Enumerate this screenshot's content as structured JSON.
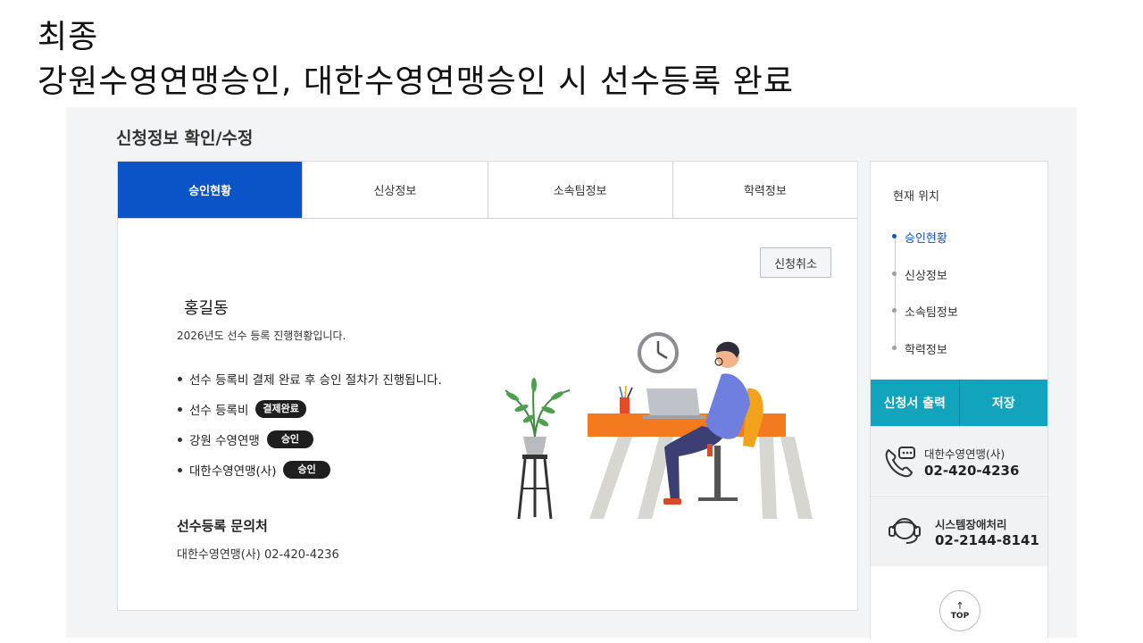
{
  "slide": {
    "line1": "최종",
    "line2": "강원수영연맹승인, 대한수영연맹승인 시 선수등록 완료"
  },
  "page": {
    "title": "신청정보 확인/수정"
  },
  "tabs": [
    {
      "label": "승인현황",
      "active": true
    },
    {
      "label": "신상정보",
      "active": false
    },
    {
      "label": "소속팀정보",
      "active": false
    },
    {
      "label": "학력정보",
      "active": false
    }
  ],
  "content": {
    "cancel_label": "신청취소",
    "name": "홍길동",
    "progress_text": "2026년도 선수 등록 진행현황입니다.",
    "bullets": [
      {
        "text": "선수 등록비 결제 완료 후 승인 절차가 진행됩니다.",
        "badge": ""
      },
      {
        "text": "선수 등록비",
        "badge": "결제완료"
      },
      {
        "text": "강원 수영연맹",
        "badge": "승인"
      },
      {
        "text": "대한수영연맹(사)",
        "badge": "승인"
      }
    ],
    "contact_title": "선수등록 문의처",
    "contact_text": "대한수영연맹(사) 02-420-4236"
  },
  "sidebar": {
    "location_title": "현재 위치",
    "location_items": [
      {
        "label": "승인현황",
        "active": true
      },
      {
        "label": "신상정보",
        "active": false
      },
      {
        "label": "소속팀정보",
        "active": false
      },
      {
        "label": "학력정보",
        "active": false
      }
    ],
    "print_label": "신청서 출력",
    "save_label": "저장",
    "contact1": {
      "label": "대한수영연맹(사)",
      "phone": "02-420-4236",
      "icon": "phone-chat-icon"
    },
    "contact2": {
      "label": "시스템장애처리",
      "phone": "02-2144-8141",
      "icon": "headset-icon"
    },
    "top_label": "TOP"
  },
  "colors": {
    "primary_blue": "#0a54c8",
    "teal": "#12a3bd",
    "badge_dark": "#1f1f1f"
  }
}
